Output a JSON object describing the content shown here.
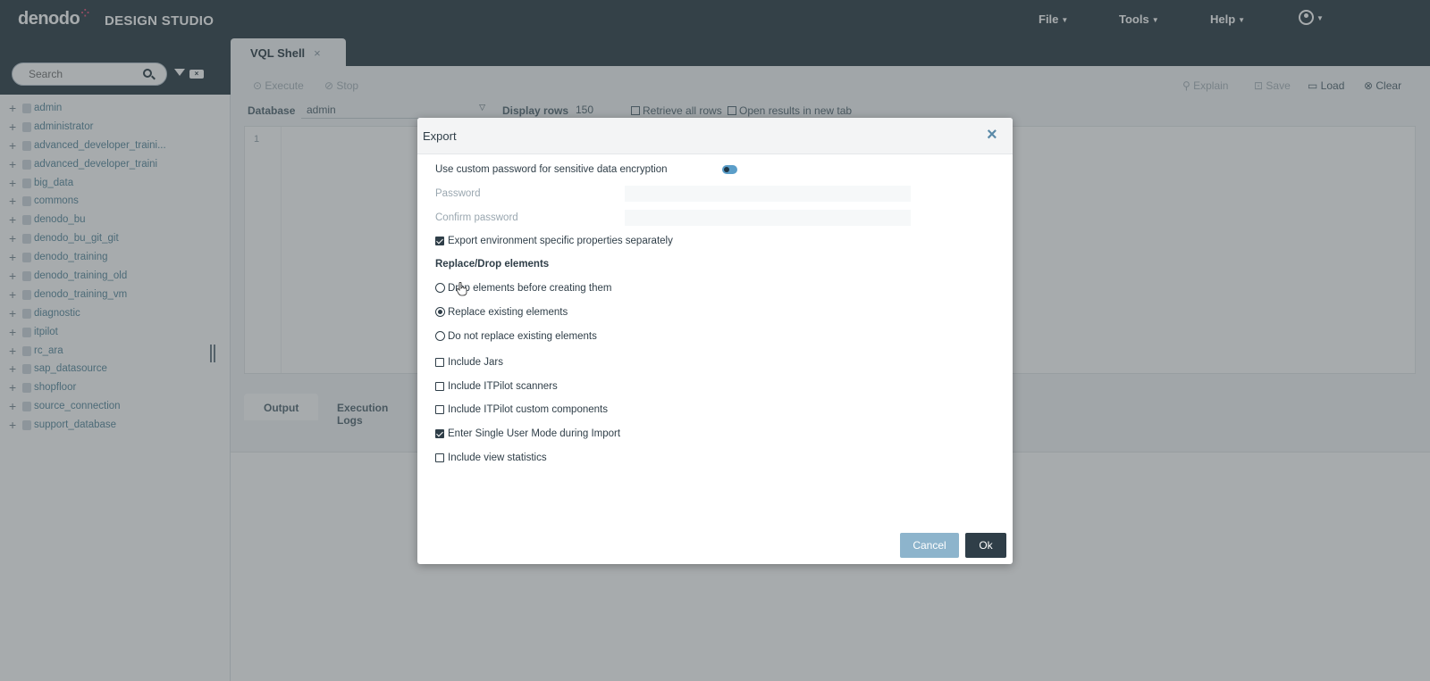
{
  "app": {
    "brand": "denodo",
    "brand_suffix": "DESIGN STUDIO"
  },
  "menu": {
    "file": "File",
    "tools": "Tools",
    "help": "Help"
  },
  "tabs": [
    {
      "label": "VQL Shell",
      "close": "×"
    }
  ],
  "sidebar": {
    "search_placeholder": "Search",
    "items": [
      "admin",
      "administrator",
      "advanced_developer_traini...",
      "advanced_developer_traini",
      "big_data",
      "commons",
      "denodo_bu",
      "denodo_bu_git_git",
      "denodo_training",
      "denodo_training_old",
      "denodo_training_vm",
      "diagnostic",
      "itpilot",
      "rc_ara",
      "sap_datasource",
      "shopfloor",
      "source_connection",
      "support_database"
    ]
  },
  "toolbar": {
    "execute": "Execute",
    "stop": "Stop",
    "explain": "Explain",
    "save": "Save",
    "load": "Load",
    "clear": "Clear"
  },
  "query": {
    "database_label": "Database",
    "database_value": "admin",
    "display_rows_label": "Display rows",
    "display_rows_value": "150",
    "retrieve_all": "Retrieve all rows",
    "open_new_tab": "Open results in new tab",
    "line_number": "1"
  },
  "output_tabs": [
    "Output",
    "Execution Logs"
  ],
  "dialog": {
    "title": "Export",
    "close": "×",
    "custom_password_label": "Use custom password for sensitive data encryption",
    "custom_password_enabled": true,
    "password_label": "Password",
    "confirm_password_label": "Confirm password",
    "export_env_label": "Export environment specific properties separately",
    "export_env_checked": true,
    "replace_section": "Replace/Drop elements",
    "radio_options": [
      {
        "label": "Drop elements before creating them",
        "selected": false
      },
      {
        "label": "Replace existing elements",
        "selected": true
      },
      {
        "label": "Do not replace existing elements",
        "selected": false
      }
    ],
    "checkbox_options": [
      {
        "label": "Include Jars",
        "checked": false
      },
      {
        "label": "Include ITPilot scanners",
        "checked": false
      },
      {
        "label": "Include ITPilot custom components",
        "checked": false
      },
      {
        "label": "Enter Single User Mode during Import",
        "checked": true
      },
      {
        "label": "Include view statistics",
        "checked": false
      }
    ],
    "cancel_label": "Cancel",
    "ok_label": "Ok"
  },
  "colors": {
    "header": "#2f3e48",
    "accent": "#5b9ec9",
    "cancel": "#8db4cc",
    "ok": "#2f3e48"
  }
}
